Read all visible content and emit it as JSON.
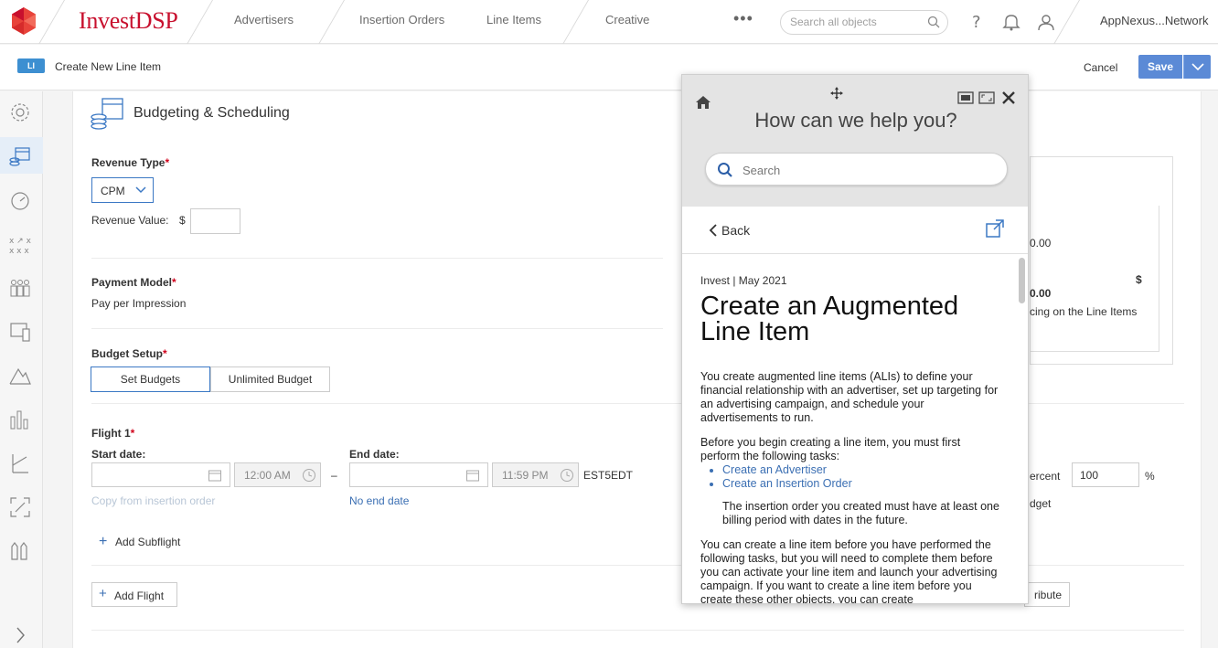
{
  "brand": {
    "name_main": "Invest",
    "name_suffix": "DSP",
    "color": "#c8102e"
  },
  "nav": {
    "items": [
      "Advertisers",
      "Insertion Orders",
      "Line Items",
      "Creative"
    ],
    "more": "•••",
    "search_placeholder": "Search all objects",
    "account": "AppNexus...Network"
  },
  "subbar": {
    "badge": "LI",
    "title": "Create New Line Item",
    "cancel": "Cancel",
    "save": "Save"
  },
  "section": {
    "title": "Budgeting & Scheduling",
    "revenue_type_label": "Revenue Type",
    "revenue_type_value": "CPM",
    "revenue_value_label": "Revenue Value:",
    "currency": "$",
    "payment_model_label": "Payment Model",
    "payment_model_value": "Pay per Impression",
    "budget_setup_label": "Budget Setup",
    "set_budgets": "Set Budgets",
    "unlimited_budget": "Unlimited Budget",
    "flight_label": "Flight 1",
    "start_date_label": "Start date:",
    "start_time": "12:00 AM",
    "dash": "–",
    "end_date_label": "End date:",
    "end_time": "11:59 PM",
    "timezone": "EST5EDT",
    "copy_from_io": "Copy from insertion order",
    "no_end_date": "No end date",
    "add_subflight": "Add Subflight",
    "add_flight": "Add Flight",
    "required_mark": "*",
    "plus": "+"
  },
  "right_panel": {
    "val1": "0.00",
    "val2": "0.00",
    "dollar": "$",
    "pacing": "cing on the Line Items",
    "percent_label": "ercent",
    "percent_value": "100",
    "percent_sign": "%",
    "budget_frag": "dget",
    "distribute_frag": "ribute"
  },
  "help": {
    "title": "How can we help you?",
    "search_placeholder": "Search",
    "back": "Back",
    "meta": "Invest | May 2021",
    "heading": "Create an Augmented Line Item",
    "p1": "You create augmented line items (ALIs) to define your financial relationship with an advertiser, set up targeting for an advertising campaign, and schedule your advertisements to run.",
    "p2": "Before you begin creating a line item, you must first perform the following tasks:",
    "links": [
      "Create an Advertiser",
      "Create an Insertion Order"
    ],
    "note": "The insertion order you created must have at least one billing period with dates in the future.",
    "p3": "You can create a line item before you have performed the following tasks, but you will need to complete them before you can activate your line item and launch your advertising campaign. If you want to create a line item before you create these other objects, you can create"
  },
  "colors": {
    "accent": "#5b8ad6",
    "link": "#3b6fb3",
    "required": "#d0021b"
  }
}
